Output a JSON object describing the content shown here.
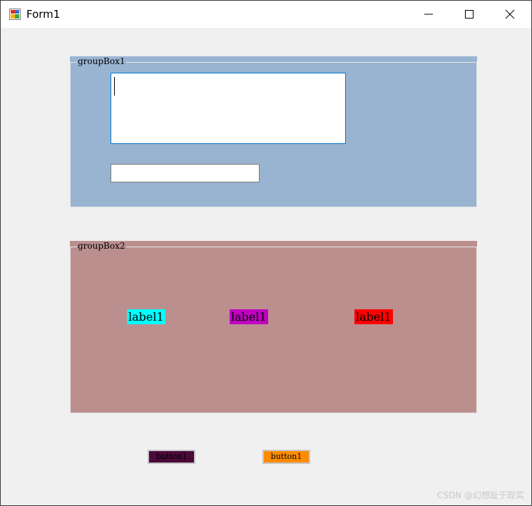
{
  "window": {
    "title": "Form1",
    "icon": "winforms-app-icon",
    "controls": {
      "minimize_icon": "minimize-icon",
      "maximize_icon": "maximize-icon",
      "close_icon": "close-icon"
    }
  },
  "groupBox1": {
    "caption": "groupBox1",
    "background": "#99b4d1",
    "multiline_text": "",
    "single_text": ""
  },
  "groupBox2": {
    "caption": "groupBox2",
    "background": "#bc8f8f",
    "labels": [
      {
        "text": "label1",
        "background": "#00ffff"
      },
      {
        "text": "label1",
        "background": "#c000c0"
      },
      {
        "text": "label1",
        "background": "#ff0000"
      }
    ]
  },
  "buttons": [
    {
      "text": "button1",
      "background": "#4a0a3a"
    },
    {
      "text": "button1",
      "background": "#ff8c00"
    }
  ],
  "watermark": "CSDN @幻想趾于现实"
}
